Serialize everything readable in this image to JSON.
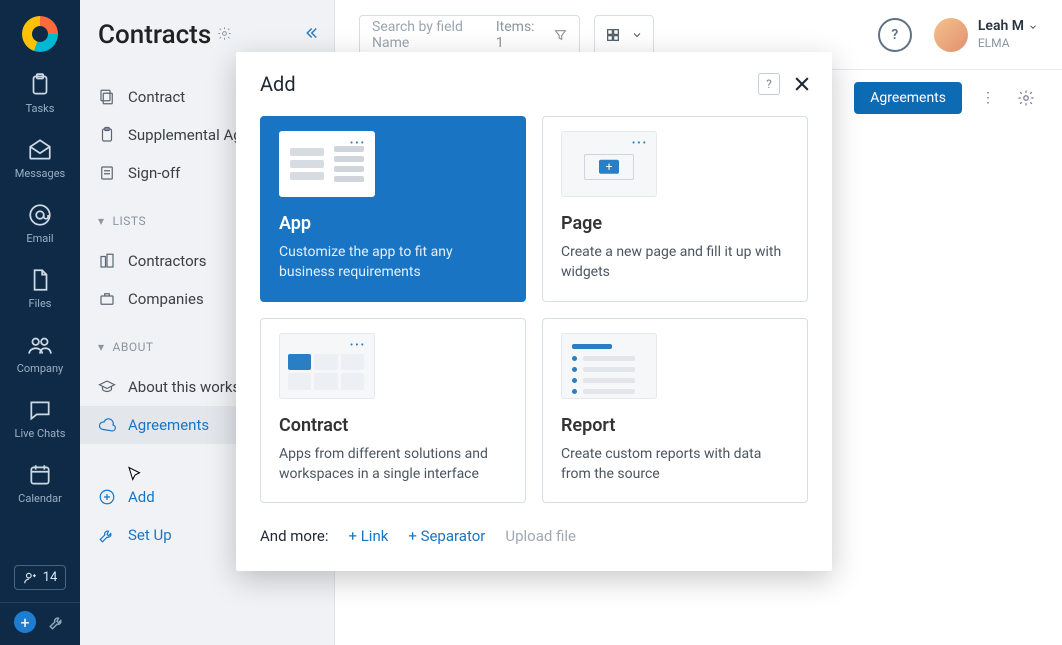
{
  "rail": {
    "items": [
      {
        "label": "Tasks"
      },
      {
        "label": "Messages"
      },
      {
        "label": "Email"
      },
      {
        "label": "Files"
      },
      {
        "label": "Company"
      },
      {
        "label": "Live Chats"
      },
      {
        "label": "Calendar"
      }
    ],
    "badge_count": "14"
  },
  "sidebar": {
    "title": "Contracts",
    "items": [
      {
        "label": "Contract"
      },
      {
        "label": "Supplemental Agre"
      },
      {
        "label": "Sign-off"
      }
    ],
    "lists_header": "LISTS",
    "lists": [
      {
        "label": "Contractors"
      },
      {
        "label": "Companies"
      }
    ],
    "about_header": "ABOUT",
    "about": [
      {
        "label": "About this worksp"
      },
      {
        "label": "Agreements",
        "active": true
      }
    ],
    "actions": {
      "add_label": "Add",
      "setup_label": "Set Up"
    }
  },
  "topbar": {
    "search_placeholder": "Search by field Name",
    "items_label": "Items: 1",
    "user_name": "Leah M",
    "user_sub": "ELMA"
  },
  "subbar": {
    "tab_label": "Agreements"
  },
  "modal": {
    "title": "Add",
    "cards": [
      {
        "title": "App",
        "desc": "Customize the app to fit any business requirements"
      },
      {
        "title": "Page",
        "desc": "Create a new page and fill it up with widgets"
      },
      {
        "title": "Contract",
        "desc": "Apps from different solutions and workspaces in a single interface"
      },
      {
        "title": "Report",
        "desc": "Create custom reports with data from the source"
      }
    ],
    "footer": {
      "label": "And more:",
      "link": "+ Link",
      "separator": "+ Separator",
      "upload": "Upload file"
    }
  }
}
